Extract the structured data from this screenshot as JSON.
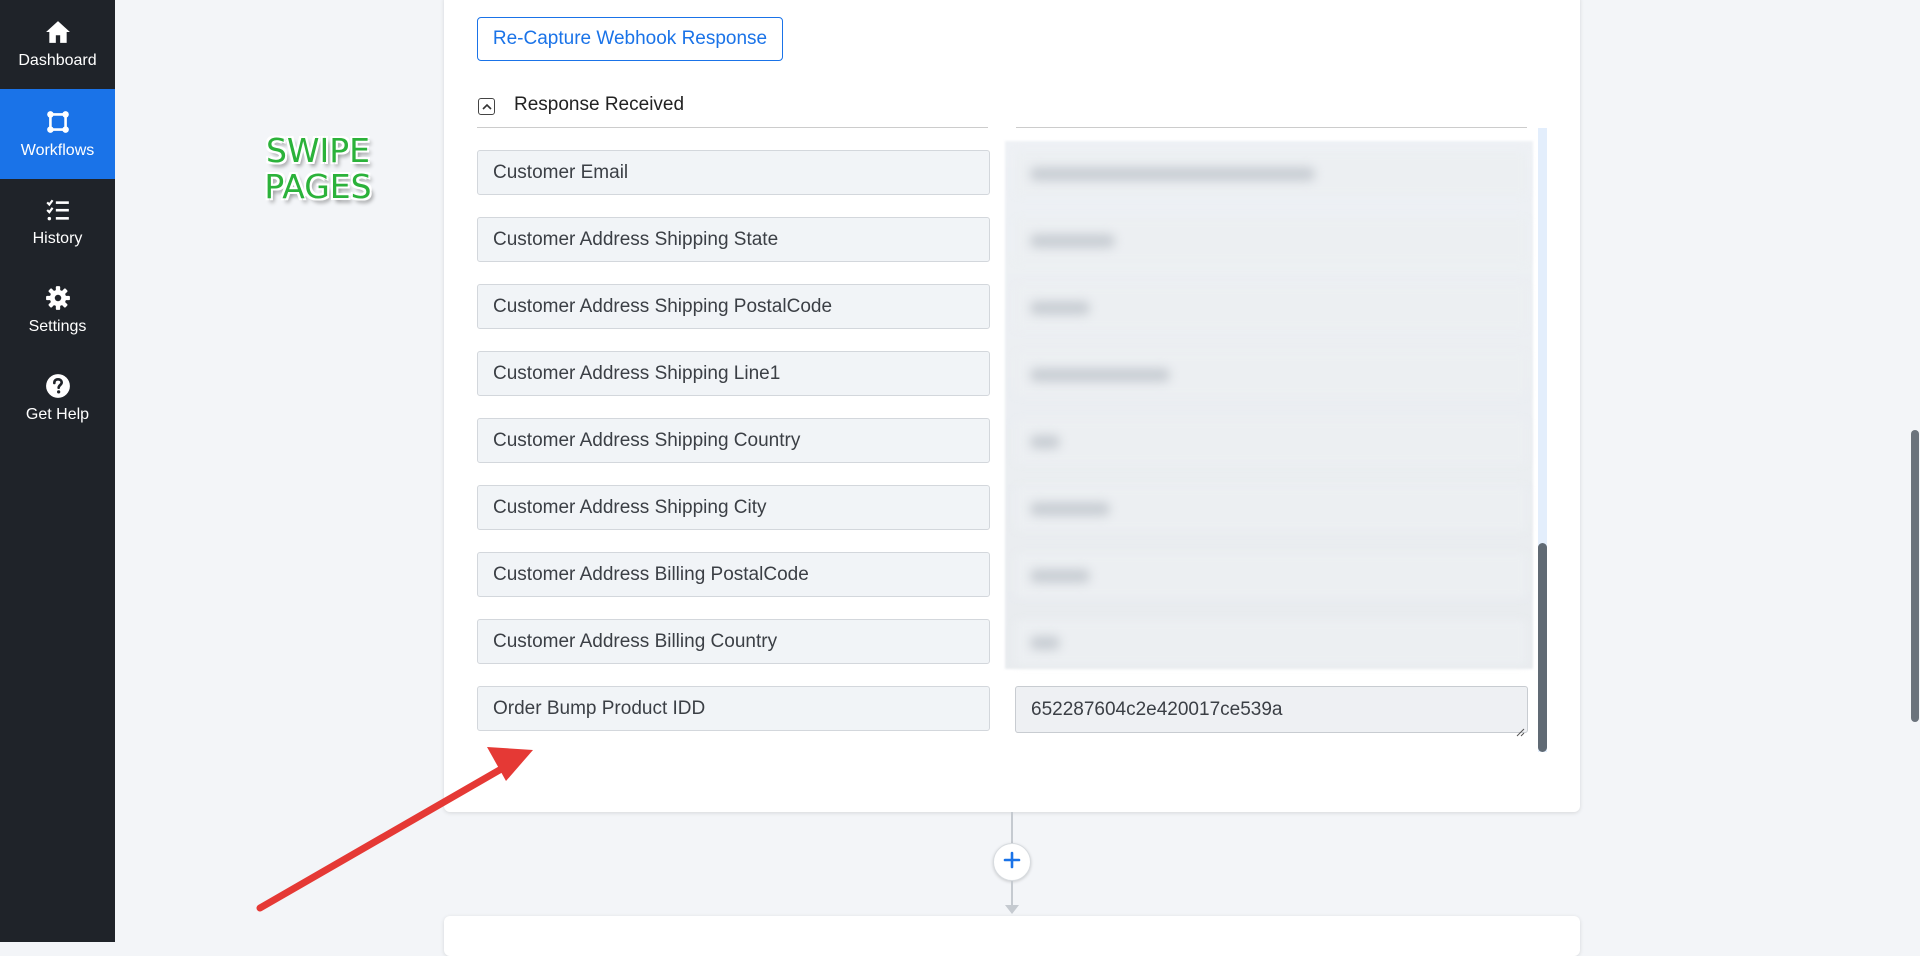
{
  "sidebar": {
    "items": [
      {
        "label": "Dashboard",
        "icon": "home-icon",
        "active": false
      },
      {
        "label": "Workflows",
        "icon": "workflow-icon",
        "active": true
      },
      {
        "label": "History",
        "icon": "history-icon",
        "active": false
      },
      {
        "label": "Settings",
        "icon": "gear-icon",
        "active": false
      },
      {
        "label": "Get Help",
        "icon": "help-icon",
        "active": false
      }
    ]
  },
  "logo": {
    "line1": "SWIPE",
    "line2": "PAGES"
  },
  "webhook": {
    "recapture_label": "Re-Capture Webhook Response",
    "section_title": "Response Received",
    "rows": [
      {
        "label": "Customer Email"
      },
      {
        "label": "Customer Address Shipping State"
      },
      {
        "label": "Customer Address Shipping PostalCode"
      },
      {
        "label": "Customer Address Shipping Line1"
      },
      {
        "label": "Customer Address Shipping Country"
      },
      {
        "label": "Customer Address Shipping City"
      },
      {
        "label": "Customer Address Billing PostalCode"
      },
      {
        "label": "Customer Address Billing Country"
      },
      {
        "label": "Order Bump Product IDD",
        "value": "652287604c2e420017ce539a"
      }
    ]
  },
  "colors": {
    "accent": "#1a73e8",
    "sidebar_bg": "#1f2329",
    "annotation_arrow": "#e53935",
    "logo_green": "#2bb23a"
  }
}
